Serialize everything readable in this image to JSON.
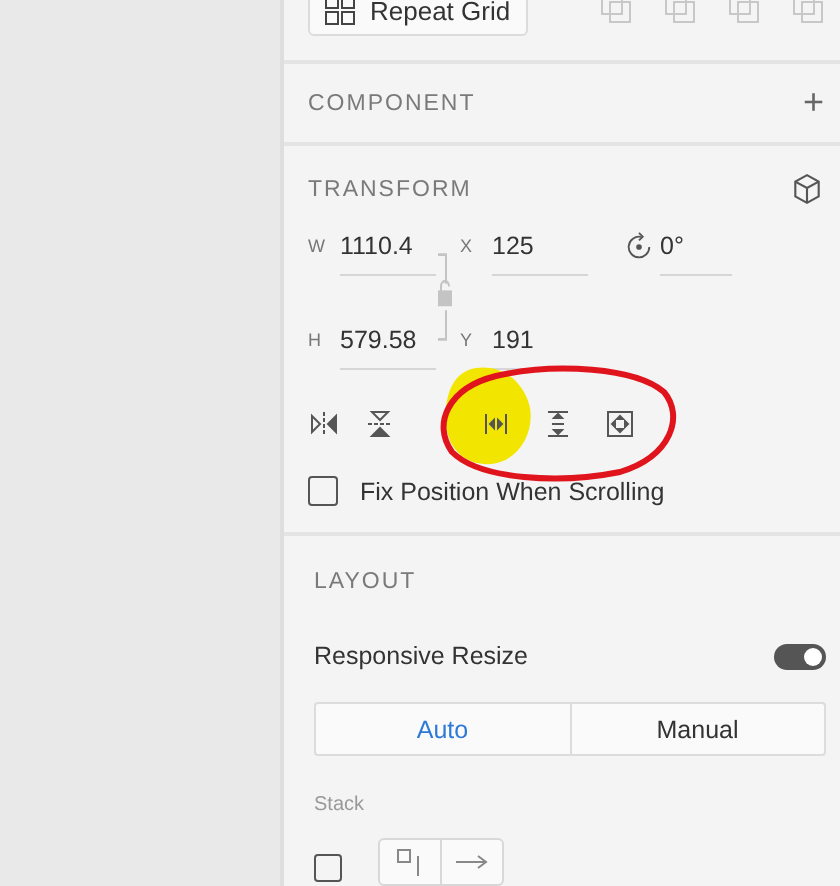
{
  "top_bar": {
    "repeat_grid": "Repeat Grid",
    "path_operations": [
      {
        "disabled": true
      },
      {
        "disabled": true
      },
      {
        "disabled": true
      },
      {
        "disabled": true
      }
    ]
  },
  "component": {
    "title": "COMPONENT",
    "add": "+"
  },
  "transform": {
    "title": "TRANSFORM",
    "fields": [
      {
        "kind": "size",
        "label": "W",
        "value": "1110.4"
      },
      {
        "kind": "position",
        "label": "X",
        "value": "125"
      },
      {
        "kind": "rotation",
        "value": "0°"
      },
      {
        "kind": "size",
        "label": "H",
        "value": "579.58"
      },
      {
        "kind": "position",
        "label": "Y",
        "value": "191"
      }
    ],
    "fix_position": {
      "label": "Fix Position When Scrolling",
      "checked": false
    }
  },
  "layout": {
    "title": "LAYOUT",
    "responsive_resize": {
      "label": "Responsive Resize",
      "on": true
    },
    "modes": [
      {
        "label": "Auto",
        "selected": true
      },
      {
        "label": "Manual",
        "selected": false
      }
    ],
    "stack": {
      "label": "Stack",
      "checked": false
    }
  },
  "annotations": [
    {
      "kind": "highlight",
      "color": "#f2e600"
    },
    {
      "kind": "ellipse",
      "color": "#e0141c"
    }
  ]
}
